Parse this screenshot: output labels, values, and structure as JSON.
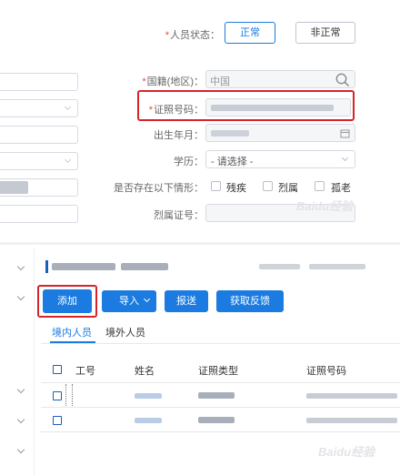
{
  "status": {
    "label": "人员状态：",
    "normal": "正常",
    "abnormal": "非正常"
  },
  "form": {
    "country_label": "国籍(地区)：",
    "country_value": "中国",
    "id_label": "证照号码：",
    "birth_label": "出生年月：",
    "edu_label": "学历：",
    "edu_placeholder": "- 请选择 -",
    "condition_label": "是否存在以下情形：",
    "conditions": [
      "残疾",
      "烈属",
      "孤老"
    ],
    "martyr_label": "烈属证号："
  },
  "toolbar": {
    "add": "添加",
    "import": "导入",
    "submit": "报送",
    "feedback": "获取反馈"
  },
  "tabs": {
    "domestic": "境内人员",
    "foreign": "境外人员"
  },
  "table": {
    "headers": [
      "工号",
      "姓名",
      "证照类型",
      "证照号码"
    ]
  },
  "watermark": "Baidu经验",
  "colors": {
    "accent": "#1b7be0",
    "highlight": "#d8232a",
    "required": "#e94a3f"
  }
}
